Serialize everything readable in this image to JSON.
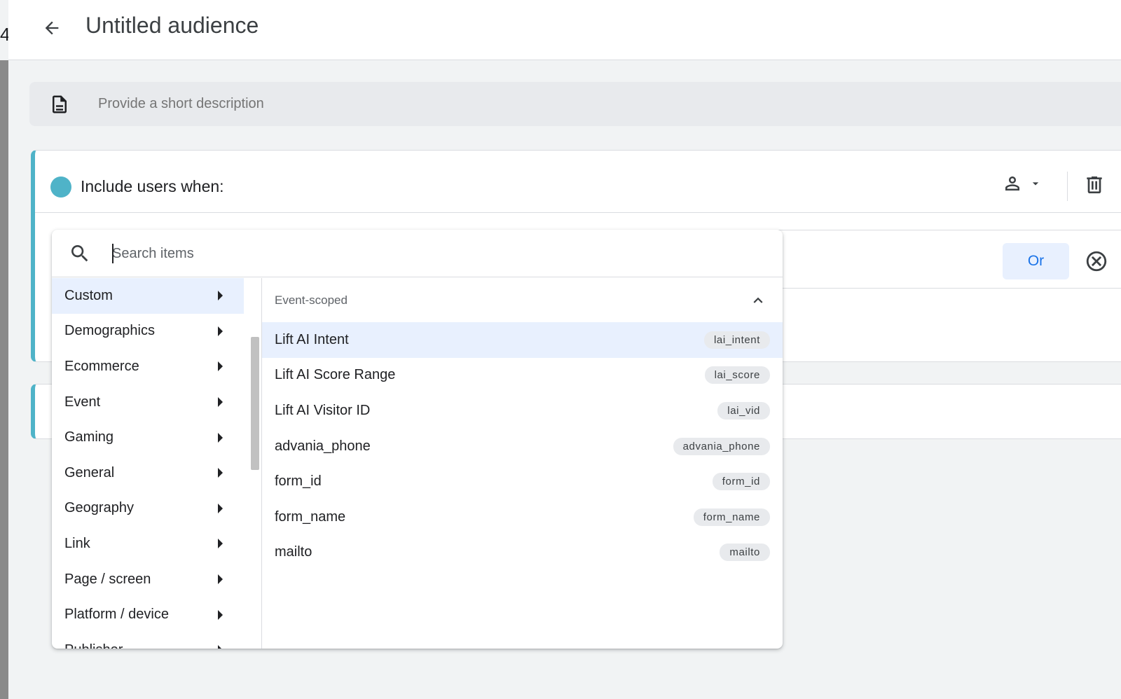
{
  "header": {
    "title": "Untitled audience"
  },
  "edge": {
    "stub_text": "4"
  },
  "description": {
    "placeholder": "Provide a short description"
  },
  "include_card": {
    "title": "Include users when:",
    "or_label": "Or"
  },
  "colors": {
    "accent": "#4fb3c8",
    "active_bg": "#e8f0fe",
    "link_blue": "#1a73e8"
  },
  "picker": {
    "search_placeholder": "Search items",
    "categories": [
      {
        "label": "Custom",
        "active": true
      },
      {
        "label": "Demographics"
      },
      {
        "label": "Ecommerce"
      },
      {
        "label": "Event"
      },
      {
        "label": "Gaming"
      },
      {
        "label": "General"
      },
      {
        "label": "Geography"
      },
      {
        "label": "Link"
      },
      {
        "label": "Page / screen"
      },
      {
        "label": "Platform / device"
      },
      {
        "label": "Publisher"
      }
    ],
    "section_title": "Event-scoped",
    "items": [
      {
        "label": "Lift AI Intent",
        "tag": "lai_intent",
        "active": true
      },
      {
        "label": "Lift AI Score Range",
        "tag": "lai_score"
      },
      {
        "label": "Lift AI Visitor ID",
        "tag": "lai_vid"
      },
      {
        "label": "advania_phone",
        "tag": "advania_phone"
      },
      {
        "label": "form_id",
        "tag": "form_id"
      },
      {
        "label": "form_name",
        "tag": "form_name"
      },
      {
        "label": "mailto",
        "tag": "mailto"
      }
    ]
  }
}
